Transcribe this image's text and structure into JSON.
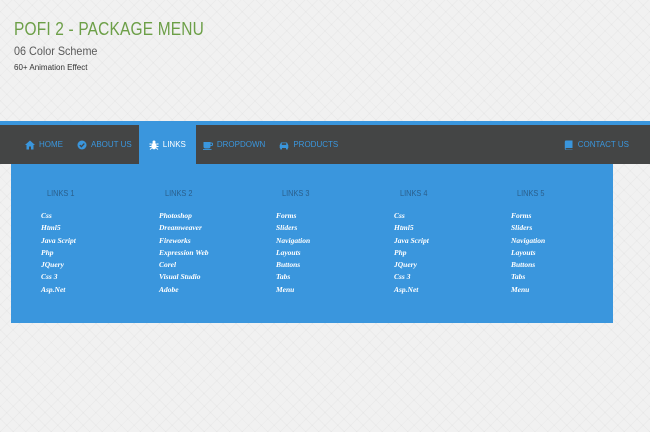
{
  "header": {
    "title": "POFI 2 - PACKAGE MENU",
    "subtitle": "06 Color Scheme",
    "tagline": "60+ Animation Effect"
  },
  "colors": {
    "accent": "#3a96dd",
    "navbar": "#444545",
    "title": "#6c9f47"
  },
  "navbar": {
    "items": [
      {
        "label": "HOME",
        "icon": "home-icon"
      },
      {
        "label": "ABOUT US",
        "icon": "check-circle-icon"
      },
      {
        "label": "LINKS",
        "icon": "bug-icon",
        "active": true
      },
      {
        "label": "DROPDOWN",
        "icon": "coffee-cup-icon"
      },
      {
        "label": "PRODUCTS",
        "icon": "car-icon"
      }
    ],
    "right_item": {
      "label": "CONTACT US",
      "icon": "book-icon"
    }
  },
  "dropdown": {
    "columns": [
      {
        "heading": "LINKS 1",
        "links": [
          "Css",
          "Html5",
          "Java Script",
          "Php",
          "JQuery",
          "Css 3",
          "Asp.Net"
        ]
      },
      {
        "heading": "LINKS 2",
        "links": [
          "Photoshop",
          "Dreamweaver",
          "Fireworks",
          "Expression Web",
          "Corel",
          "Visual Studio",
          "Adobe"
        ]
      },
      {
        "heading": "LINKS 3",
        "links": [
          "Forms",
          "Sliders",
          "Navigation",
          "Layouts",
          "Buttons",
          "Tabs",
          "Menu"
        ]
      },
      {
        "heading": "LINKS 4",
        "links": [
          "Css",
          "Html5",
          "Java Script",
          "Php",
          "JQuery",
          "Css 3",
          "Asp.Net"
        ]
      },
      {
        "heading": "LINKS 5",
        "links": [
          "Forms",
          "Sliders",
          "Navigation",
          "Layouts",
          "Buttons",
          "Tabs",
          "Menu"
        ]
      }
    ]
  }
}
